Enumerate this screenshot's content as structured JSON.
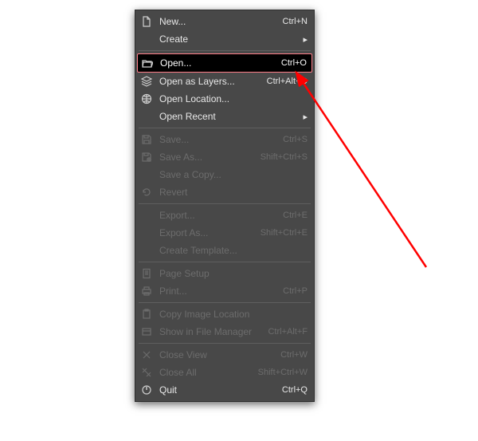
{
  "menu": {
    "items": [
      {
        "id": "new",
        "label": "New...",
        "shortcut": "Ctrl+N",
        "icon": "file-icon"
      },
      {
        "id": "create",
        "label": "Create",
        "submenu": true
      },
      {
        "separator": true
      },
      {
        "id": "open",
        "label": "Open...",
        "shortcut": "Ctrl+O",
        "icon": "folder-open-icon",
        "selected": true
      },
      {
        "id": "open-as-layers",
        "label": "Open as Layers...",
        "shortcut": "Ctrl+Alt+O",
        "icon": "layers-icon"
      },
      {
        "id": "open-location",
        "label": "Open Location...",
        "icon": "globe-icon"
      },
      {
        "id": "open-recent",
        "label": "Open Recent",
        "submenu": true
      },
      {
        "separator": true
      },
      {
        "id": "save",
        "label": "Save...",
        "shortcut": "Ctrl+S",
        "icon": "save-icon",
        "disabled": true
      },
      {
        "id": "save-as",
        "label": "Save As...",
        "shortcut": "Shift+Ctrl+S",
        "icon": "save-as-icon",
        "disabled": true
      },
      {
        "id": "save-copy",
        "label": "Save a Copy...",
        "disabled": true
      },
      {
        "id": "revert",
        "label": "Revert",
        "icon": "revert-icon",
        "disabled": true
      },
      {
        "separator": true
      },
      {
        "id": "export",
        "label": "Export...",
        "shortcut": "Ctrl+E",
        "disabled": true
      },
      {
        "id": "export-as",
        "label": "Export As...",
        "shortcut": "Shift+Ctrl+E",
        "disabled": true
      },
      {
        "id": "create-template",
        "label": "Create Template...",
        "disabled": true
      },
      {
        "separator": true
      },
      {
        "id": "page-setup",
        "label": "Page Setup",
        "icon": "page-setup-icon",
        "disabled": true
      },
      {
        "id": "print",
        "label": "Print...",
        "shortcut": "Ctrl+P",
        "icon": "print-icon",
        "disabled": true
      },
      {
        "separator": true
      },
      {
        "id": "copy-image-location",
        "label": "Copy Image Location",
        "icon": "clipboard-icon",
        "disabled": true
      },
      {
        "id": "show-in-file-manager",
        "label": "Show in File Manager",
        "shortcut": "Ctrl+Alt+F",
        "icon": "file-manager-icon",
        "disabled": true
      },
      {
        "separator": true
      },
      {
        "id": "close-view",
        "label": "Close View",
        "shortcut": "Ctrl+W",
        "icon": "close-icon",
        "disabled": true
      },
      {
        "id": "close-all",
        "label": "Close All",
        "shortcut": "Shift+Ctrl+W",
        "icon": "close-all-icon",
        "disabled": true
      },
      {
        "id": "quit",
        "label": "Quit",
        "shortcut": "Ctrl+Q",
        "icon": "quit-icon"
      }
    ]
  },
  "annotation": {
    "arrow_color": "#ff0000"
  }
}
